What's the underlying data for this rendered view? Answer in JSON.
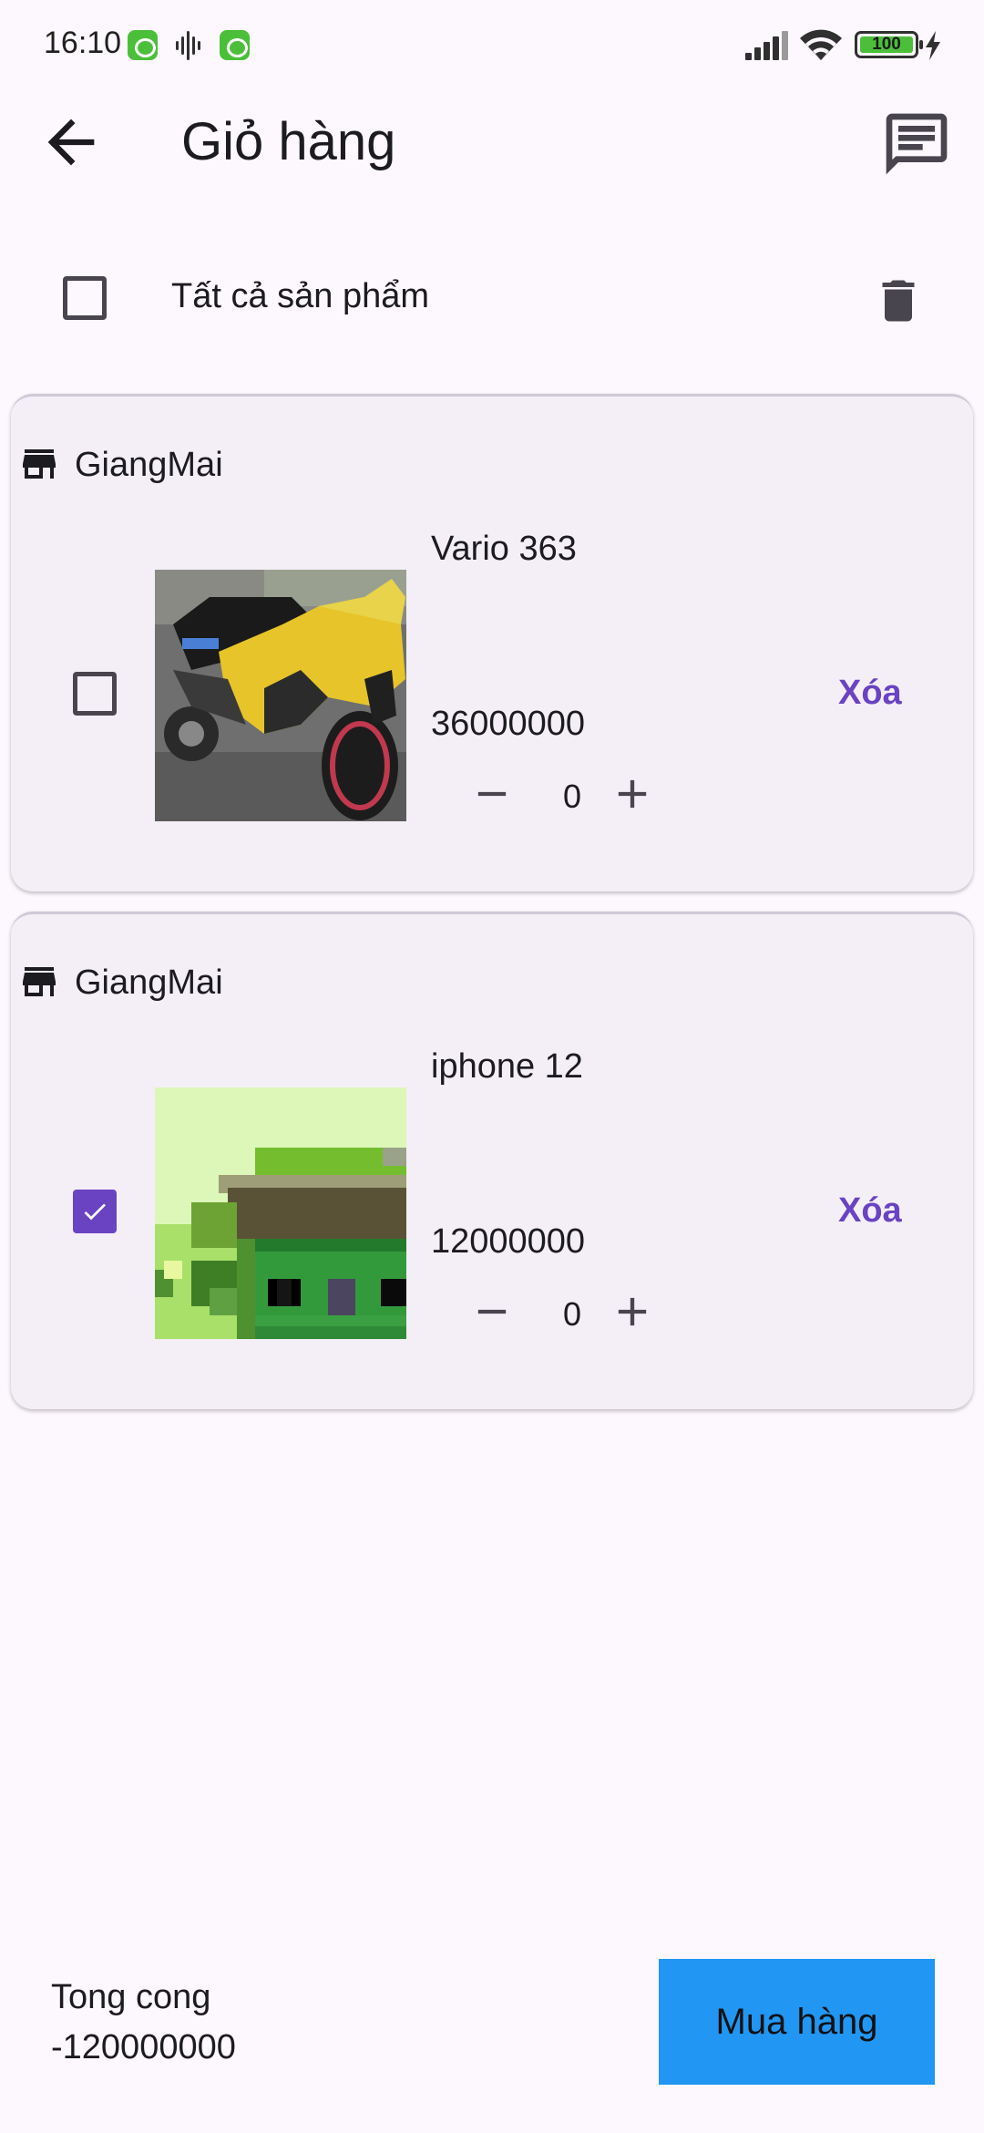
{
  "status_bar": {
    "time": "16:10",
    "battery": "100",
    "icons": [
      "app-notification-icon",
      "voice-recorder-icon",
      "app-notification-icon",
      "signal-icon",
      "wifi-icon",
      "battery-icon",
      "charging-icon"
    ]
  },
  "app_bar": {
    "title": "Giỏ hàng",
    "back_icon": "arrow-back-icon",
    "chat_icon": "message-icon"
  },
  "select_all": {
    "label": "Tất cả sản phẩm",
    "checked": false,
    "delete_icon": "trash-icon"
  },
  "shops": [
    {
      "shop_name": "GiangMai",
      "store_icon": "store-icon",
      "item": {
        "name": "Vario 363",
        "price": "36000000",
        "quantity": "0",
        "checked": false,
        "remove_label": "Xóa"
      }
    },
    {
      "shop_name": "GiangMai",
      "store_icon": "store-icon",
      "item": {
        "name": "iphone 12",
        "price": "12000000",
        "quantity": "0",
        "checked": true,
        "remove_label": "Xóa"
      }
    }
  ],
  "footer": {
    "total_label": "Tong cong",
    "total_value": "-120000000",
    "buy_label": "Mua hàng"
  },
  "colors": {
    "accent": "#6a43c2",
    "buy_button": "#2196f3",
    "card_background": "#f4eff7",
    "page_background": "#fdf8fd"
  }
}
